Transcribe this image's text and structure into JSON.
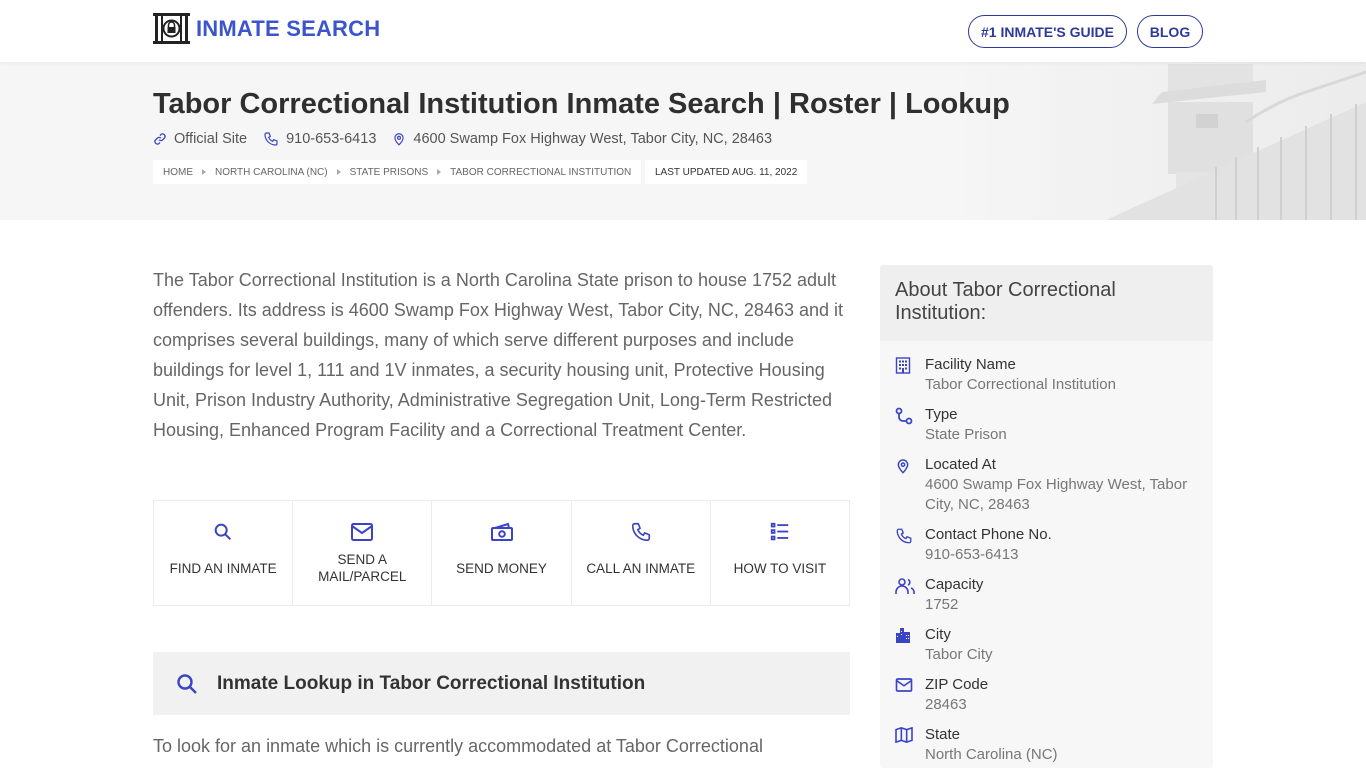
{
  "header": {
    "logo_text": "INMATE SEARCH",
    "nav": [
      {
        "label": "#1 INMATE'S GUIDE"
      },
      {
        "label": "BLOG"
      }
    ]
  },
  "hero": {
    "title": "Tabor Correctional Institution Inmate Search | Roster | Lookup",
    "official_site": "Official Site",
    "phone": "910-653-6413",
    "address": "4600 Swamp Fox Highway West, Tabor City, NC, 28463",
    "breadcrumbs": [
      "HOME",
      "NORTH CAROLINA (NC)",
      "STATE PRISONS",
      "TABOR CORRECTIONAL INSTITUTION"
    ],
    "last_updated": "LAST UPDATED AUG. 11, 2022"
  },
  "main": {
    "intro": "The Tabor Correctional Institution is a North Carolina State prison to house 1752 adult offenders. Its address is 4600 Swamp Fox Highway West, Tabor City, NC, 28463 and it comprises several buildings, many of which serve different purposes and include buildings for level 1, 111 and 1V inmates, a security housing unit, Protective Housing Unit, Prison Industry Authority, Administrative Segregation Unit, Long-Term Restricted Housing, Enhanced Program Facility and a Correctional Treatment Center.",
    "actions": [
      {
        "label": "FIND AN INMATE",
        "icon": "search-icon"
      },
      {
        "label": "SEND A MAIL/PARCEL",
        "icon": "mail-icon"
      },
      {
        "label": "SEND MONEY",
        "icon": "money-icon"
      },
      {
        "label": "CALL AN INMATE",
        "icon": "phone-icon"
      },
      {
        "label": "HOW TO VISIT",
        "icon": "list-icon"
      }
    ],
    "lookup_title": "Inmate Lookup in Tabor Correctional Institution",
    "lookup_text": "To look for an inmate which is currently accommodated at Tabor Correctional"
  },
  "sidebar": {
    "title": "About Tabor Correctional Institution:",
    "items": [
      {
        "label": "Facility Name",
        "value": "Tabor Correctional Institution",
        "icon": "building-icon"
      },
      {
        "label": "Type",
        "value": "State Prison",
        "icon": "route-icon"
      },
      {
        "label": "Located At",
        "value": "4600 Swamp Fox Highway West, Tabor City, NC, 28463",
        "icon": "map-pin-icon"
      },
      {
        "label": "Contact Phone No.",
        "value": "910-653-6413",
        "icon": "phone-icon"
      },
      {
        "label": "Capacity",
        "value": "1752",
        "icon": "users-icon"
      },
      {
        "label": "City",
        "value": "Tabor City",
        "icon": "city-icon"
      },
      {
        "label": "ZIP Code",
        "value": "28463",
        "icon": "mail-icon"
      },
      {
        "label": "State",
        "value": "North Carolina (NC)",
        "icon": "map-icon"
      }
    ]
  },
  "colors": {
    "brand": "#3d55cc",
    "nav_border": "#2e3a99",
    "icon": "#3b45c4",
    "title": "#2f2f2f",
    "body_text": "#666666"
  }
}
